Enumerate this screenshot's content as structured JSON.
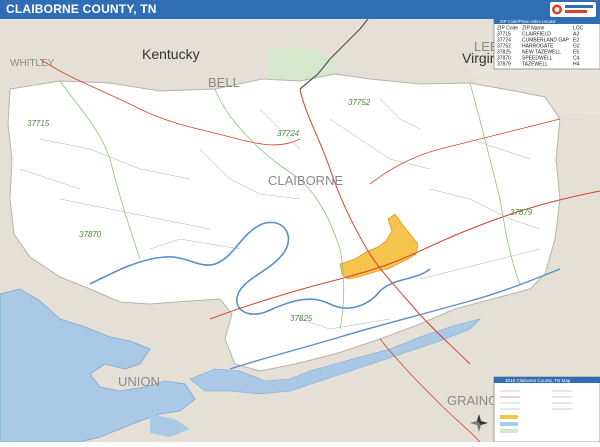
{
  "header": {
    "title": "CLAIBORNE COUNTY, TN"
  },
  "brand": {
    "logo_icon": "market-maps-logo-icon"
  },
  "labels": {
    "state_kentucky": "Kentucky",
    "state_virginia": "Virgin",
    "county_whitley": "WHITLEY",
    "county_bell": "BELL",
    "county_lee": "LEE",
    "county_claiborne": "CLAIBORNE",
    "county_union": "UNION",
    "county_grainger": "GRAING"
  },
  "zip_labels": [
    "37752",
    "37715",
    "37724",
    "37870",
    "37825",
    "37879"
  ],
  "zip_table": {
    "title": "ZIP Code/Place Index Locator",
    "headers": [
      "ZIP Code",
      "ZIP Name",
      "LOC"
    ],
    "rows": [
      [
        "37715",
        "CLAIRFIELD",
        "A3"
      ],
      [
        "37724",
        "CUMBERLAND GAP",
        "E2"
      ],
      [
        "37752",
        "HARROGATE",
        "G2"
      ],
      [
        "37825",
        "NEW TAZEWELL",
        "E5"
      ],
      [
        "37870",
        "SPEEDWELL",
        "C4"
      ],
      [
        "37879",
        "TAZEWELL",
        "H4"
      ]
    ]
  },
  "legend": {
    "title": "2016 Claiborne County, TN Map"
  },
  "colors": {
    "header_blue": "#2f6db5",
    "outside_area": "#e5e0d6",
    "county_fill": "#ffffff",
    "lake_water": "#a9c9e6",
    "river": "#5a8fc8",
    "urban_area": "#f6c34c",
    "highway": "#d9412a",
    "zip_label": "#4a8a3c",
    "national_park": "#d6e8cc"
  },
  "icons": {
    "compass": "compass-rose-icon"
  }
}
